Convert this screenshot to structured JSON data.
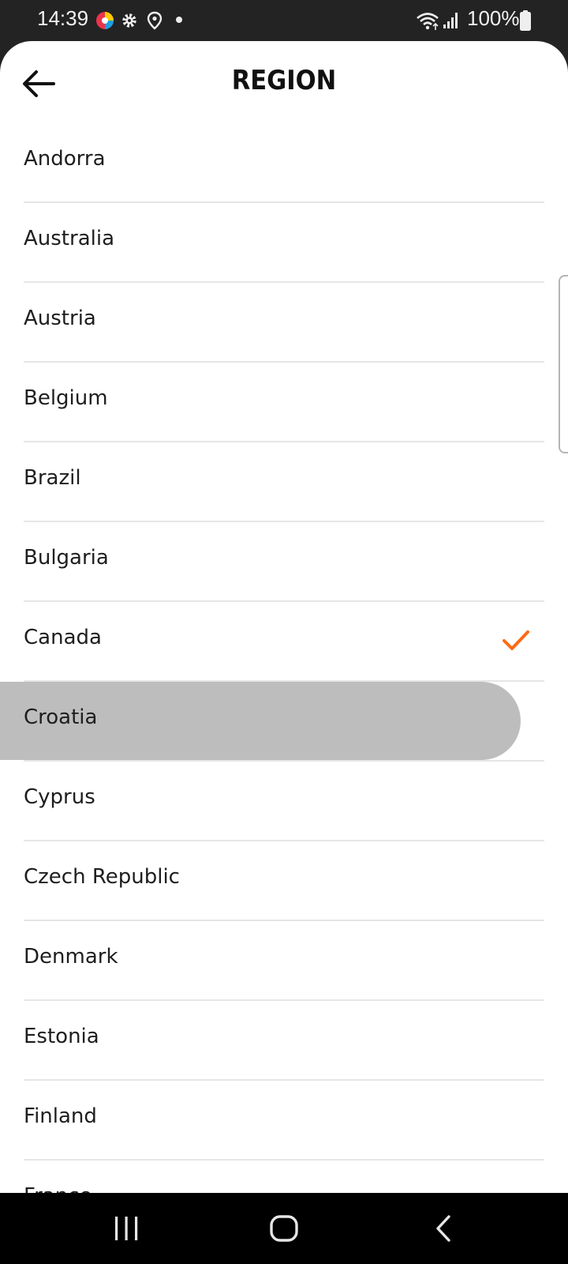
{
  "status_bar": {
    "time": "14:39",
    "battery": "100%",
    "icons": [
      "app-notification-icon",
      "gear-icon",
      "location-icon",
      "dot-icon",
      "wifi-icon",
      "signal-icon",
      "battery-icon"
    ]
  },
  "header": {
    "title": "REGION",
    "back_icon": "arrow-left-icon"
  },
  "regions": [
    {
      "label": "Andorra"
    },
    {
      "label": "Australia"
    },
    {
      "label": "Austria"
    },
    {
      "label": "Belgium"
    },
    {
      "label": "Brazil"
    },
    {
      "label": "Bulgaria"
    },
    {
      "label": "Canada",
      "selected": true
    },
    {
      "label": "Croatia",
      "pressed": true
    },
    {
      "label": "Cyprus"
    },
    {
      "label": "Czech Republic"
    },
    {
      "label": "Denmark"
    },
    {
      "label": "Estonia"
    },
    {
      "label": "Finland"
    },
    {
      "label": "France"
    }
  ],
  "colors": {
    "accent": "#ff6a13",
    "pressed": "#bdbdbd",
    "divider": "#e6e6e6"
  },
  "nav_bar": {
    "icons": [
      "recent-apps-icon",
      "home-icon",
      "back-icon"
    ]
  }
}
